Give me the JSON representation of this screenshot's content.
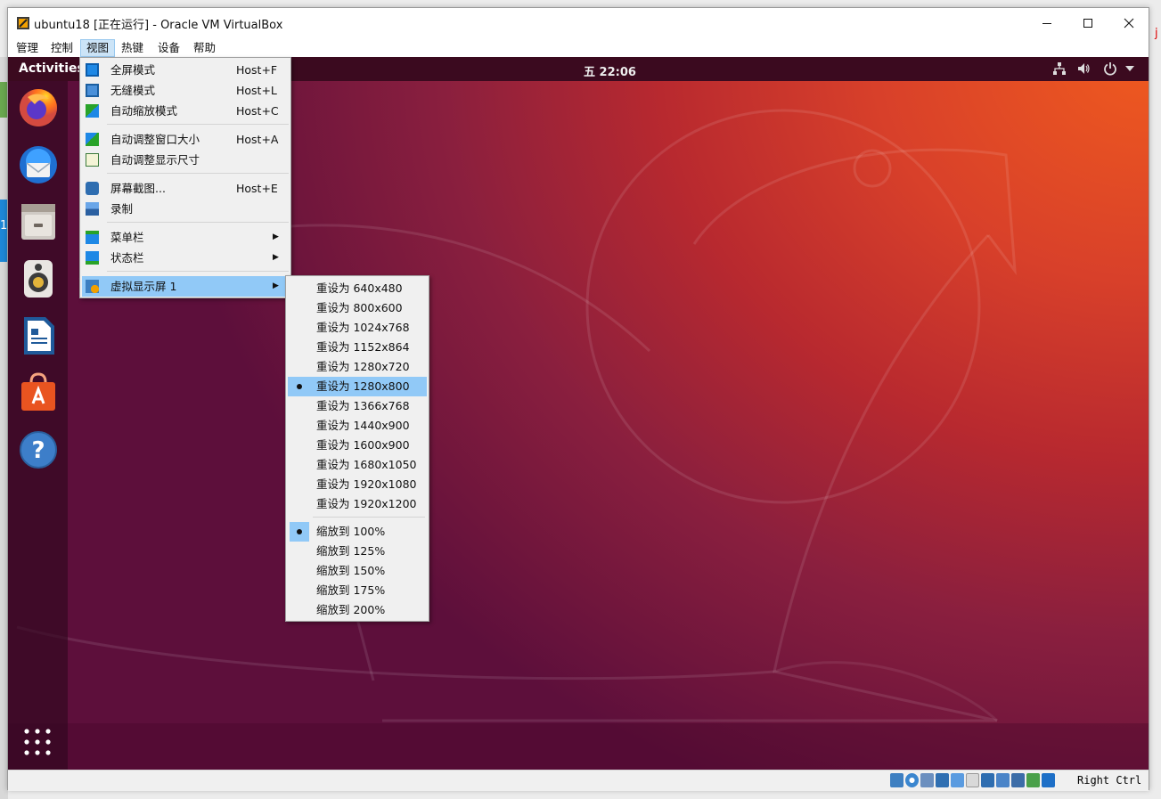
{
  "window": {
    "title": "ubuntu18 [正在运行] - Oracle VM VirtualBox",
    "controls": [
      "minimize-icon",
      "maximize-icon",
      "close-icon"
    ]
  },
  "menubar": [
    "管理",
    "控制",
    "视图",
    "热键",
    "设备",
    "帮助"
  ],
  "guest": {
    "activities": "Activities",
    "clock": "五 22:06",
    "tray_icons": [
      "network-icon",
      "volume-icon",
      "power-icon",
      "caret-down-icon"
    ],
    "dock_apps": [
      "firefox-icon",
      "thunderbird-icon",
      "files-icon",
      "rhythmbox-icon",
      "libreoffice-writer-icon",
      "software-center-icon",
      "help-icon"
    ],
    "show_apps_icon": "app-grid-icon"
  },
  "view_menu": {
    "items": [
      {
        "label": "全屏模式",
        "shortcut": "Host+F",
        "icon": "fullscreen-icon"
      },
      {
        "label": "无缝模式",
        "shortcut": "Host+L",
        "icon": "seamless-icon"
      },
      {
        "label": "自动缩放模式",
        "shortcut": "Host+C",
        "icon": "scale-icon"
      },
      {
        "label": "自动调整窗口大小",
        "shortcut": "Host+A",
        "icon": "adjust-window-icon"
      },
      {
        "label": "自动调整显示尺寸",
        "shortcut": "",
        "icon": "auto-resize-icon"
      },
      {
        "label": "屏幕截图...",
        "shortcut": "Host+E",
        "icon": "screenshot-icon"
      },
      {
        "label": "录制",
        "shortcut": "",
        "icon": "record-icon"
      },
      {
        "label": "菜单栏",
        "shortcut": "",
        "icon": "menubar-icon",
        "submenu": true
      },
      {
        "label": "状态栏",
        "shortcut": "",
        "icon": "statusbar-icon",
        "submenu": true
      },
      {
        "label": "虚拟显示屏 1",
        "shortcut": "",
        "icon": "virtual-screen-icon",
        "submenu": true
      }
    ]
  },
  "screen_submenu": {
    "resize_items": [
      "重设为 640x480",
      "重设为 800x600",
      "重设为 1024x768",
      "重设为 1152x864",
      "重设为 1280x720",
      "重设为 1280x800",
      "重设为 1366x768",
      "重设为 1440x900",
      "重设为 1600x900",
      "重设为 1680x1050",
      "重设为 1920x1080",
      "重设为 1920x1200"
    ],
    "scale_items": [
      "缩放到 100%",
      "缩放到 125%",
      "缩放到 150%",
      "缩放到 175%",
      "缩放到 200%"
    ],
    "selected_resize": "重设为 1280x800",
    "selected_scale": "缩放到 100%"
  },
  "statusbar": {
    "icons": [
      "hard-disk-icon",
      "optical-drive-icon",
      "audio-icon",
      "network-adapter-icon",
      "usb-icon",
      "shared-folders-icon",
      "display-icon",
      "video-capture-icon",
      "virtualization-icon",
      "mouse-integration-icon",
      "keyboard-capture-icon"
    ],
    "host_key": "Right Ctrl"
  },
  "colors": {
    "ubuntu_orange": "#e95420",
    "ubuntu_aubergine": "#5e2750",
    "menu_highlight": "#91c9f7",
    "menubar_active": "#cce4f7"
  }
}
